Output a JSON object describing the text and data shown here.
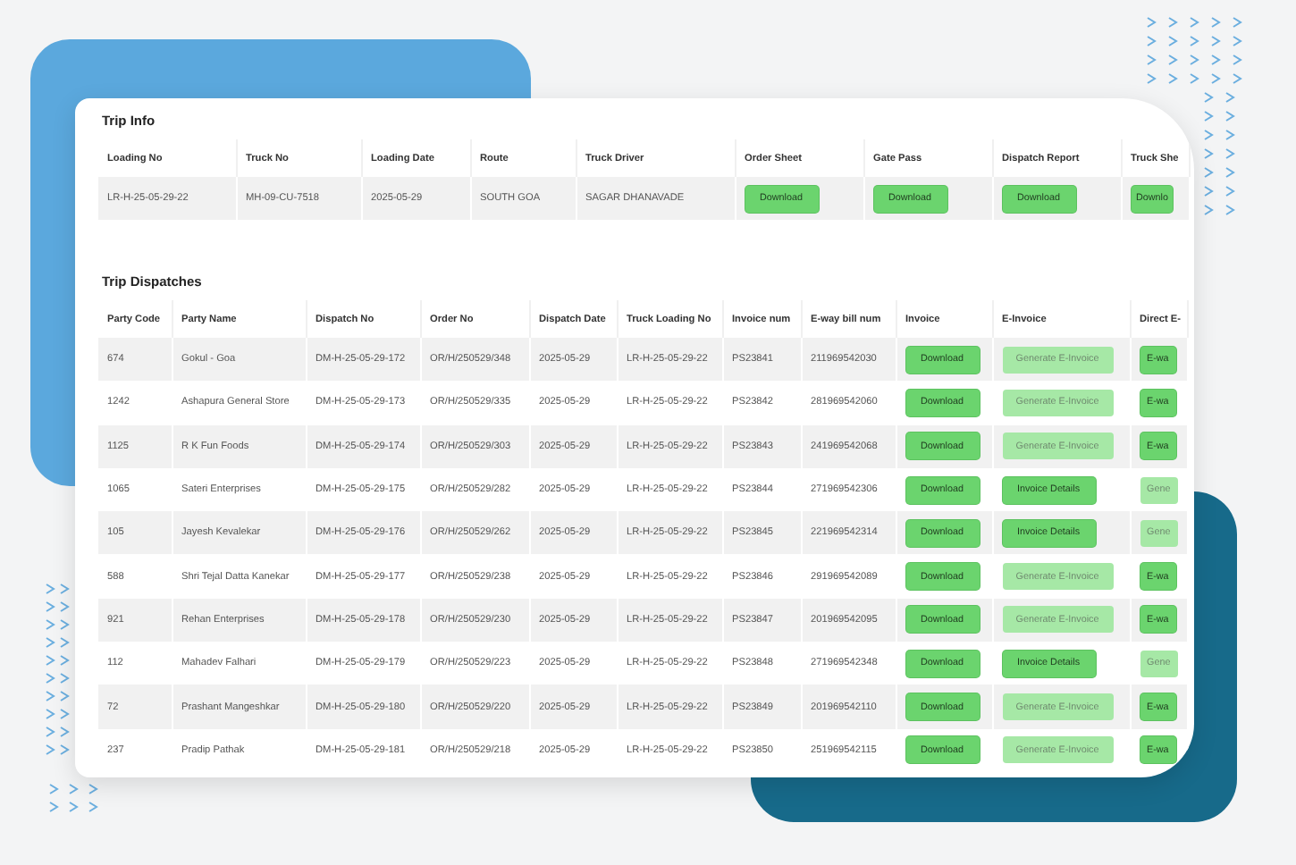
{
  "trip_info": {
    "title": "Trip Info",
    "columns": [
      "Loading No",
      "Truck No",
      "Loading Date",
      "Route",
      "Truck Driver",
      "Order Sheet",
      "Gate Pass",
      "Dispatch Report",
      "Truck She"
    ],
    "row": {
      "cells": [
        "LR-H-25-05-29-22",
        "MH-09-CU-7518",
        "2025-05-29",
        "SOUTH GOA",
        "SAGAR DHANAVADE"
      ],
      "buttons": [
        "Download",
        "Download",
        "Download",
        "Downlo"
      ]
    }
  },
  "trip_dispatches": {
    "title": "Trip Dispatches",
    "columns": [
      "Party Code",
      "Party Name",
      "Dispatch No",
      "Order No",
      "Dispatch Date",
      "Truck Loading No",
      "Invoice num",
      "E-way bill num",
      "Invoice",
      "E-Invoice",
      "Direct E-"
    ],
    "rows": [
      {
        "cells": [
          "674",
          "Gokul - Goa",
          "DM-H-25-05-29-172",
          "OR/H/250529/348",
          "2025-05-29",
          "LR-H-25-05-29-22",
          "PS23841",
          "211969542030"
        ],
        "invoice": "Download",
        "e_invoice": {
          "label": "Generate E-Invoice",
          "disabled": true
        },
        "direct": {
          "label": "E-wa",
          "disabled": false
        }
      },
      {
        "cells": [
          "1242",
          "Ashapura General Store",
          "DM-H-25-05-29-173",
          "OR/H/250529/335",
          "2025-05-29",
          "LR-H-25-05-29-22",
          "PS23842",
          "281969542060"
        ],
        "invoice": "Download",
        "e_invoice": {
          "label": "Generate E-Invoice",
          "disabled": true
        },
        "direct": {
          "label": "E-wa",
          "disabled": false
        }
      },
      {
        "cells": [
          "1125",
          "R K Fun Foods",
          "DM-H-25-05-29-174",
          "OR/H/250529/303",
          "2025-05-29",
          "LR-H-25-05-29-22",
          "PS23843",
          "241969542068"
        ],
        "invoice": "Download",
        "e_invoice": {
          "label": "Generate E-Invoice",
          "disabled": true
        },
        "direct": {
          "label": "E-wa",
          "disabled": false
        }
      },
      {
        "cells": [
          "1065",
          "Sateri Enterprises",
          "DM-H-25-05-29-175",
          "OR/H/250529/282",
          "2025-05-29",
          "LR-H-25-05-29-22",
          "PS23844",
          "271969542306"
        ],
        "invoice": "Download",
        "e_invoice": {
          "label": "Invoice Details",
          "disabled": false
        },
        "direct": {
          "label": "Gene",
          "disabled": true
        }
      },
      {
        "cells": [
          "105",
          "Jayesh Kevalekar",
          "DM-H-25-05-29-176",
          "OR/H/250529/262",
          "2025-05-29",
          "LR-H-25-05-29-22",
          "PS23845",
          "221969542314"
        ],
        "invoice": "Download",
        "e_invoice": {
          "label": "Invoice Details",
          "disabled": false
        },
        "direct": {
          "label": "Gene",
          "disabled": true
        }
      },
      {
        "cells": [
          "588",
          "Shri Tejal Datta Kanekar",
          "DM-H-25-05-29-177",
          "OR/H/250529/238",
          "2025-05-29",
          "LR-H-25-05-29-22",
          "PS23846",
          "291969542089"
        ],
        "invoice": "Download",
        "e_invoice": {
          "label": "Generate E-Invoice",
          "disabled": true
        },
        "direct": {
          "label": "E-wa",
          "disabled": false
        }
      },
      {
        "cells": [
          "921",
          "Rehan Enterprises",
          "DM-H-25-05-29-178",
          "OR/H/250529/230",
          "2025-05-29",
          "LR-H-25-05-29-22",
          "PS23847",
          "201969542095"
        ],
        "invoice": "Download",
        "e_invoice": {
          "label": "Generate E-Invoice",
          "disabled": true
        },
        "direct": {
          "label": "E-wa",
          "disabled": false
        }
      },
      {
        "cells": [
          "112",
          "Mahadev Falhari",
          "DM-H-25-05-29-179",
          "OR/H/250529/223",
          "2025-05-29",
          "LR-H-25-05-29-22",
          "PS23848",
          "271969542348"
        ],
        "invoice": "Download",
        "e_invoice": {
          "label": "Invoice Details",
          "disabled": false
        },
        "direct": {
          "label": "Gene",
          "disabled": true
        }
      },
      {
        "cells": [
          "72",
          "Prashant Mangeshkar",
          "DM-H-25-05-29-180",
          "OR/H/250529/220",
          "2025-05-29",
          "LR-H-25-05-29-22",
          "PS23849",
          "201969542110"
        ],
        "invoice": "Download",
        "e_invoice": {
          "label": "Generate E-Invoice",
          "disabled": true
        },
        "direct": {
          "label": "E-wa",
          "disabled": false
        }
      },
      {
        "cells": [
          "237",
          "Pradip Pathak",
          "DM-H-25-05-29-181",
          "OR/H/250529/218",
          "2025-05-29",
          "LR-H-25-05-29-22",
          "PS23850",
          "251969542115"
        ],
        "invoice": "Download",
        "e_invoice": {
          "label": "Generate E-Invoice",
          "disabled": true
        },
        "direct": {
          "label": "E-wa",
          "disabled": false
        }
      }
    ]
  }
}
